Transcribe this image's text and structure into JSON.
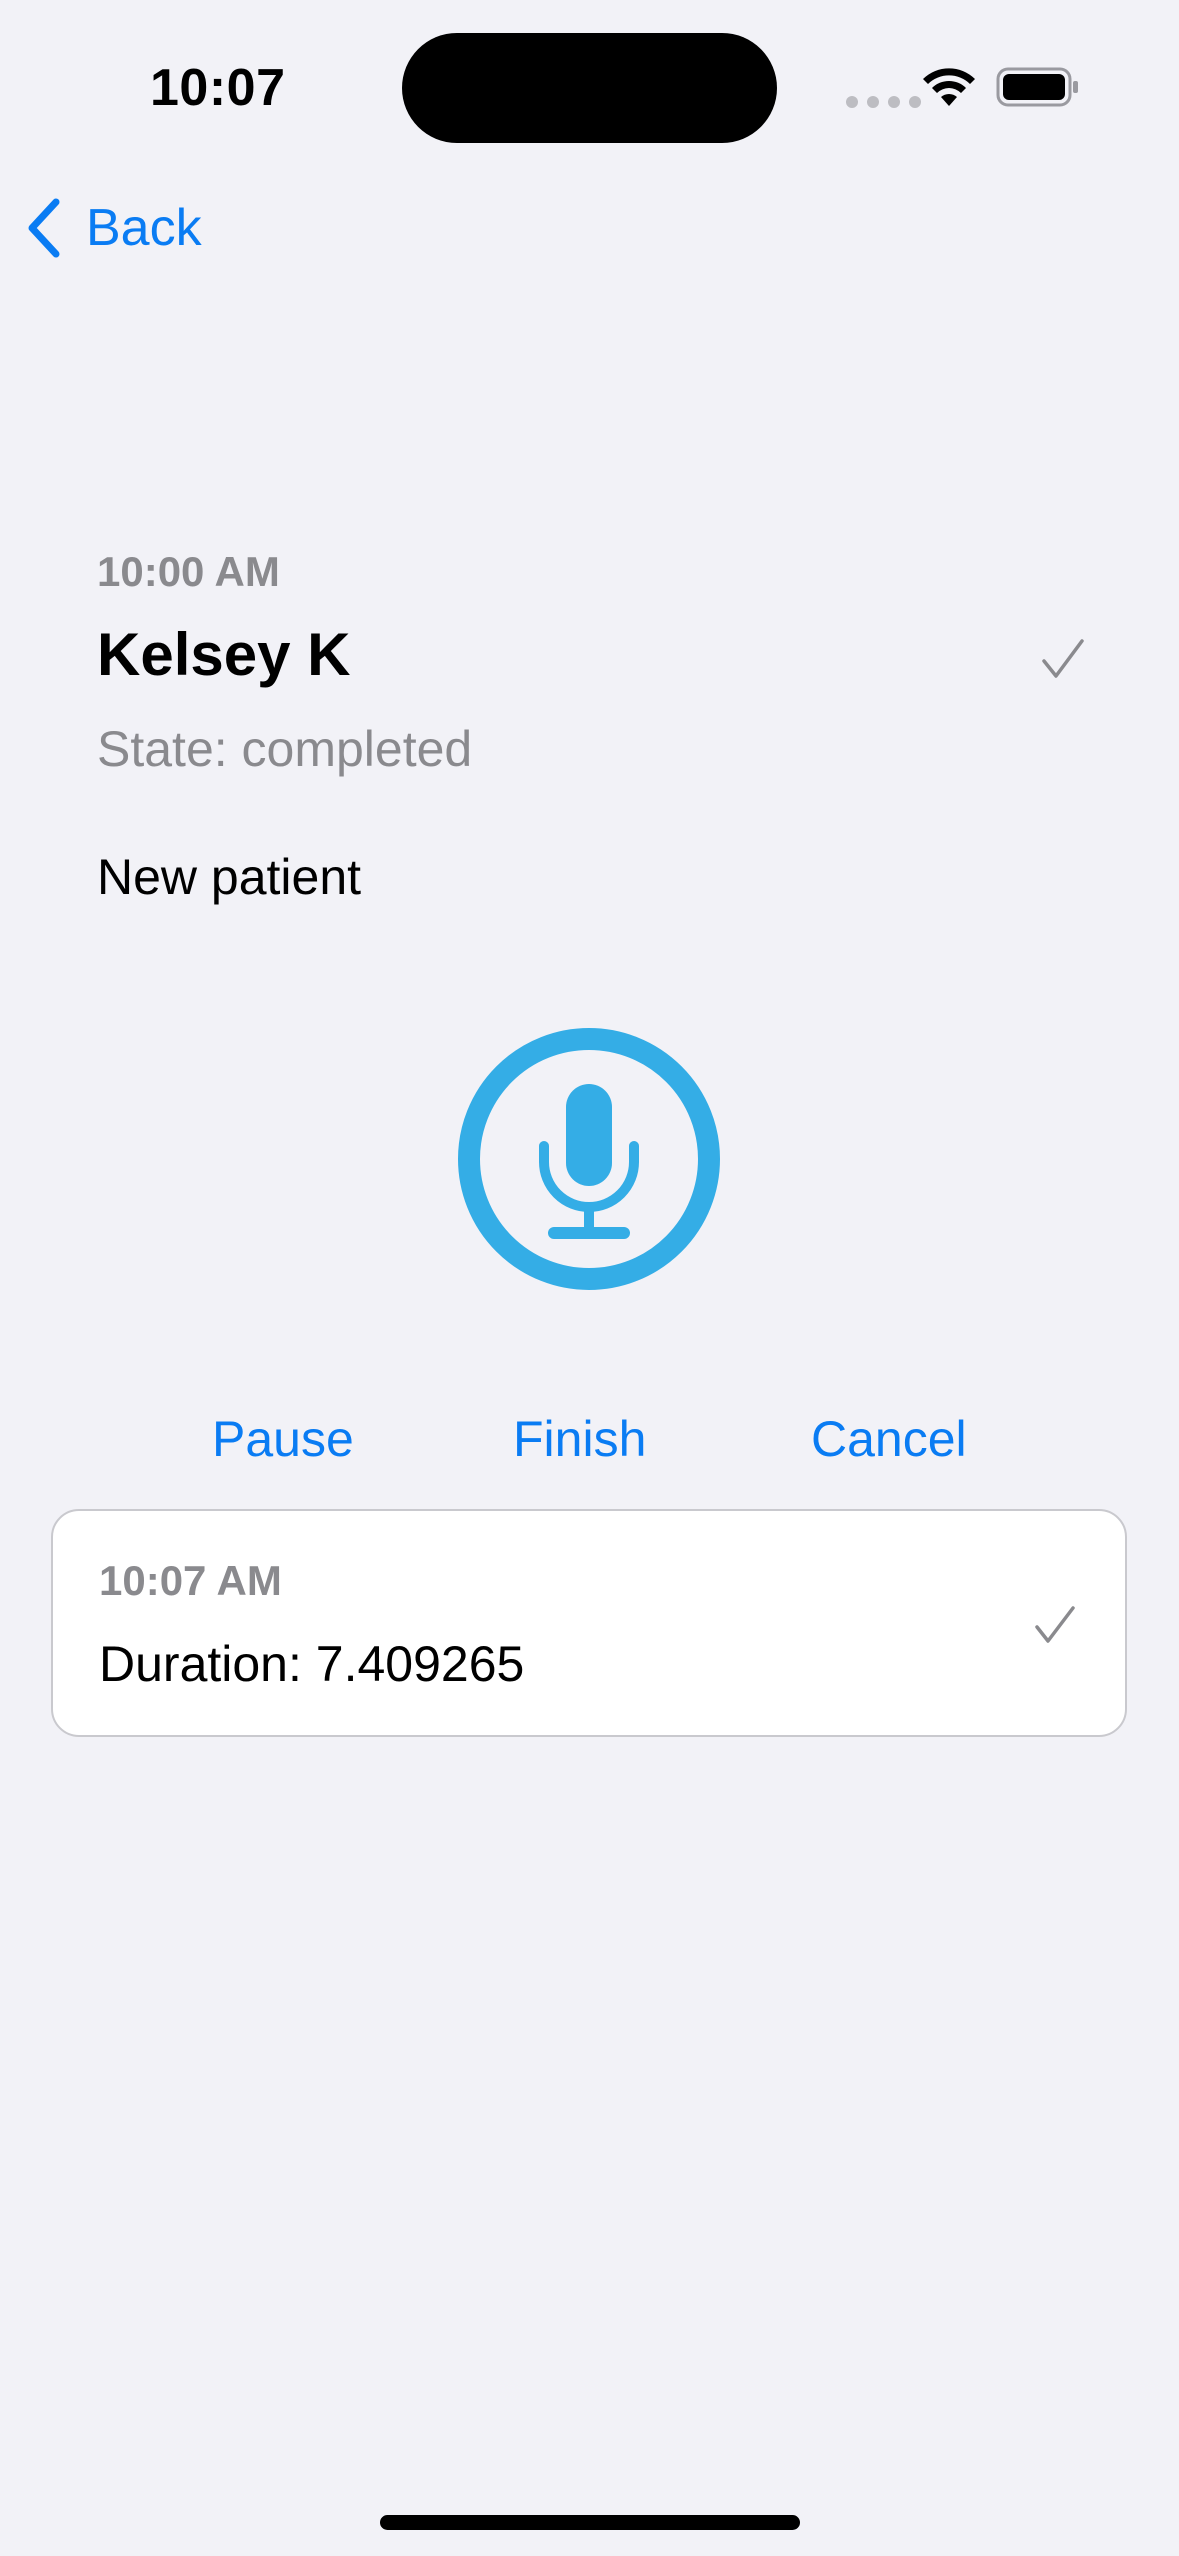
{
  "status_bar": {
    "time": "10:07",
    "icons": [
      "signal-dots-icon",
      "wifi-icon",
      "battery-icon"
    ]
  },
  "nav": {
    "back_label": "Back",
    "back_icon": "chevron-left-icon"
  },
  "appointment": {
    "time": "10:00 AM",
    "patient_name": "Kelsey K",
    "state": "State: completed",
    "status_icon": "checkmark-icon",
    "notes": "New patient"
  },
  "recorder": {
    "icon": "microphone-icon",
    "pause_label": "Pause",
    "finish_label": "Finish",
    "cancel_label": "Cancel"
  },
  "recordings": [
    {
      "time": "10:07 AM",
      "duration": "Duration: 7.409265",
      "status_icon": "checkmark-icon"
    }
  ],
  "colors": {
    "background": "#F2F2F7",
    "accent": "#0A7CF3",
    "mic": "#34ADE6",
    "secondary_text": "#8A8A8E",
    "card_border": "#C9C9CE"
  }
}
